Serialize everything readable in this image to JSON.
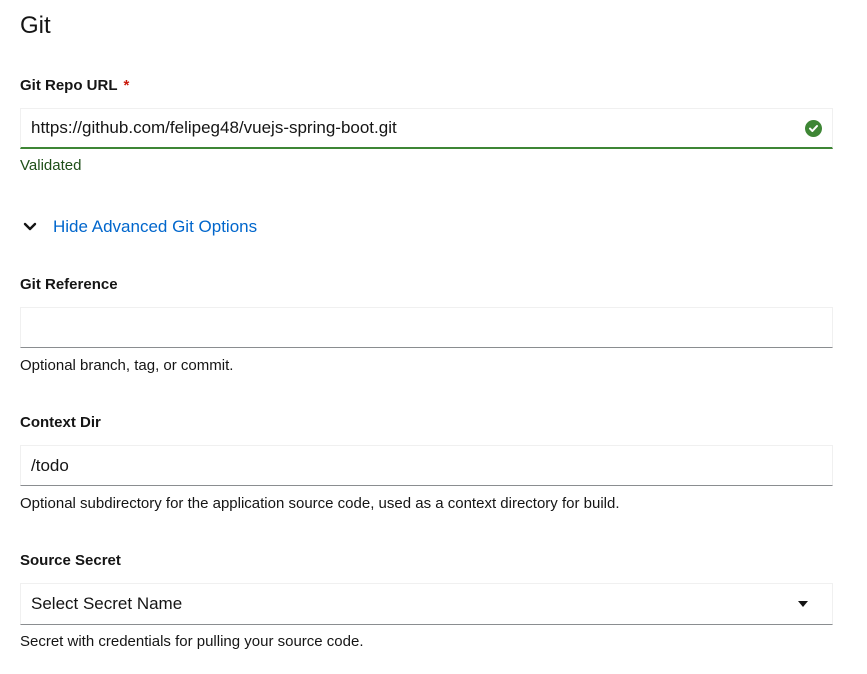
{
  "section": {
    "title": "Git"
  },
  "repo": {
    "label": "Git Repo URL",
    "required_mark": "*",
    "value": "https://github.com/felipeg48/vuejs-spring-boot.git",
    "status_icon": "check-circle-icon",
    "helper": "Validated",
    "success_color": "#3e8635"
  },
  "advanced_toggle": {
    "icon": "chevron-down-icon",
    "label": "Hide Advanced Git Options"
  },
  "reference": {
    "label": "Git Reference",
    "value": "",
    "helper": "Optional branch, tag, or commit."
  },
  "context_dir": {
    "label": "Context Dir",
    "value": "/todo",
    "helper": "Optional subdirectory for the application source code, used as a context directory for build."
  },
  "source_secret": {
    "label": "Source Secret",
    "selected": "Select Secret Name",
    "icon": "caret-down-icon",
    "helper": "Secret with credentials for pulling your source code."
  },
  "colors": {
    "link": "#0066cc",
    "required": "#c9190b",
    "border": "#8a8d90"
  }
}
